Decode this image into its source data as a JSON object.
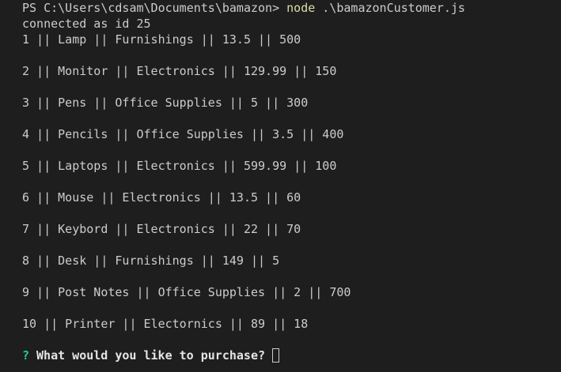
{
  "terminal": {
    "prompt_path": "PS C:\\Users\\cdsam\\Documents\\bamazon> ",
    "command_node": "node",
    "command_args": " .\\bamazonCustomer.js",
    "connection_message": "connected as id 25",
    "rows": [
      "1 || Lamp || Furnishings || 13.5 || 500",
      "2 || Monitor || Electronics || 129.99 || 150",
      "3 || Pens || Office Supplies || 5 || 300",
      "4 || Pencils || Office Supplies || 3.5 || 400",
      "5 || Laptops || Electronics || 599.99 || 100",
      "6 || Mouse || Electronics || 13.5 || 60",
      "7 || Keybord || Electronics || 22 || 70",
      "8 || Desk || Furnishings || 149 || 5",
      "9 || Post Notes || Office Supplies || 2 || 700",
      "10 || Printer || Electornics || 89 || 18"
    ],
    "question_mark": "?",
    "question_text": "What would you like to purchase?"
  },
  "colors": {
    "background": "#1e1e1e",
    "text": "#cccccc",
    "command": "#dcdcaa",
    "question_mark": "#23d18b"
  }
}
